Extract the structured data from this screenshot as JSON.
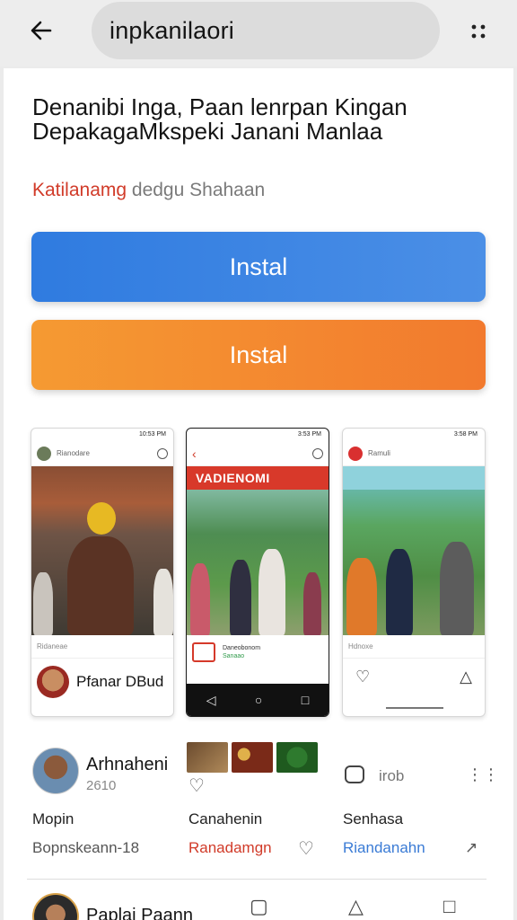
{
  "topbar": {
    "back_icon": "arrow-left-icon",
    "search_text": "inpkanilaori",
    "more_icon": "more-dots-icon"
  },
  "app": {
    "headline": "Denanibi Inga, Paan lenrpan Kingan DepakagaMkspeki Janani Manlaa",
    "subtitle_accent": "Katilanamg",
    "subtitle_rest": " dedgu Shahaan"
  },
  "buttons": {
    "install_primary": "Instal",
    "install_secondary": "Instal"
  },
  "screenshots": [
    {
      "status": "10:53 PM",
      "header": "Rianodare",
      "caption": "Ridaneae",
      "footer_name": "Pfanar DBud"
    },
    {
      "status": "3:53 PM",
      "banner": "VADIENOMI",
      "app_line1": "Daneobonom",
      "app_line2": "Sanaao"
    },
    {
      "status": "3:58 PM",
      "header": "Ramuli",
      "caption": "Hdnoxe"
    }
  ],
  "review": {
    "author": "Arhnaheni",
    "meta": "2610",
    "reply_label": "irob",
    "labels": [
      "Mopin",
      "Canahenin",
      "Senhasa"
    ],
    "values": [
      "Bopnskeann-18",
      "Ranadamgn",
      "Riandanahn"
    ]
  },
  "next_review": {
    "author": "Paplai Paann"
  }
}
